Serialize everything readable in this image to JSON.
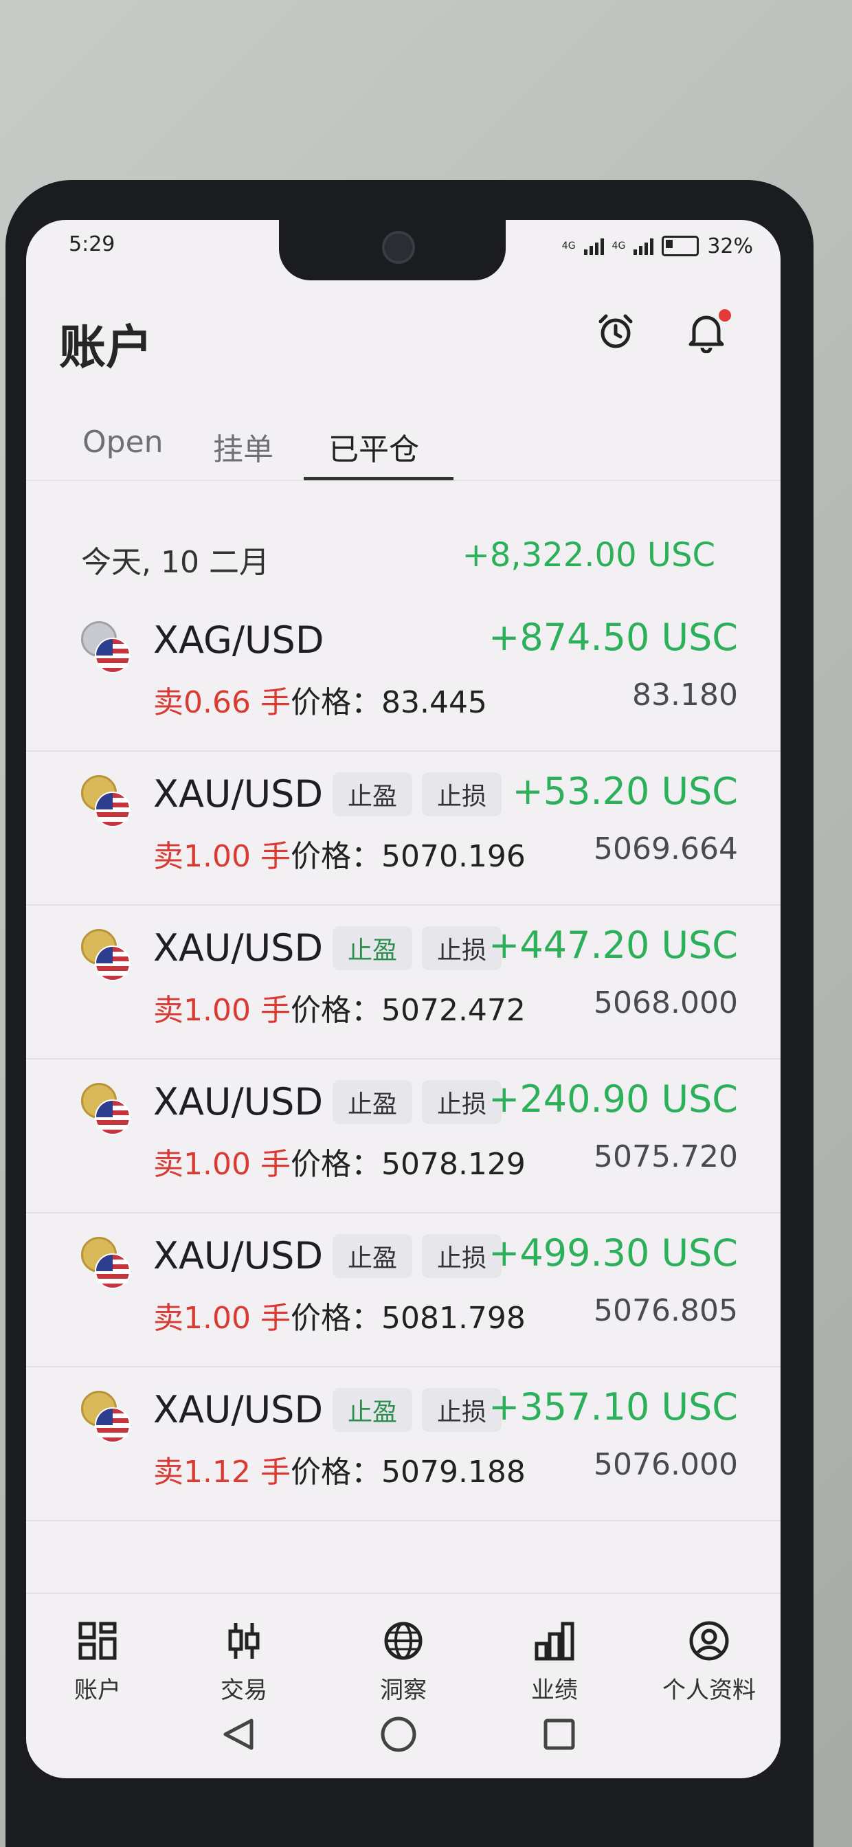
{
  "status_bar": {
    "time": "5:29",
    "network1": "4G",
    "network2": "4G",
    "battery": "32%"
  },
  "header": {
    "title": "账户",
    "icons": [
      "alarm-clock-icon",
      "bell-icon"
    ]
  },
  "tabs": [
    {
      "label": "Open",
      "active": false
    },
    {
      "label": "挂单",
      "active": false
    },
    {
      "label": "已平仓",
      "active": true
    }
  ],
  "day": {
    "label": "今天, 10 二月",
    "total": "+8,322.00 USC"
  },
  "trades": [
    {
      "symbol": "XAG/USD",
      "coin": "silver",
      "tp": "",
      "sl": "",
      "profit": "+874.50 USC",
      "side": "卖0.66 手",
      "price_label": "价格：",
      "open_price": "83.445",
      "close_price": "83.180"
    },
    {
      "symbol": "XAU/USD",
      "coin": "gold",
      "tp": "止盈",
      "sl": "止损",
      "tp_green": false,
      "profit": "+53.20 USC",
      "side": "卖1.00 手",
      "price_label": "价格：",
      "open_price": "5070.196",
      "close_price": "5069.664"
    },
    {
      "symbol": "XAU/USD",
      "coin": "gold",
      "tp": "止盈",
      "sl": "止损",
      "tp_green": true,
      "profit": "+447.20 USC",
      "side": "卖1.00 手",
      "price_label": "价格：",
      "open_price": "5072.472",
      "close_price": "5068.000"
    },
    {
      "symbol": "XAU/USD",
      "coin": "gold",
      "tp": "止盈",
      "sl": "止损",
      "tp_green": false,
      "profit": "+240.90 USC",
      "side": "卖1.00 手",
      "price_label": "价格：",
      "open_price": "5078.129",
      "close_price": "5075.720"
    },
    {
      "symbol": "XAU/USD",
      "coin": "gold",
      "tp": "止盈",
      "sl": "止损",
      "tp_green": false,
      "profit": "+499.30 USC",
      "side": "卖1.00 手",
      "price_label": "价格：",
      "open_price": "5081.798",
      "close_price": "5076.805"
    },
    {
      "symbol": "XAU/USD",
      "coin": "gold",
      "tp": "止盈",
      "sl": "止损",
      "tp_green": true,
      "profit": "+357.10 USC",
      "side": "卖1.12 手",
      "price_label": "价格：",
      "open_price": "5079.188",
      "close_price": "5076.000"
    }
  ],
  "bottom_nav": [
    {
      "label": "账户",
      "icon": "grid-icon"
    },
    {
      "label": "交易",
      "icon": "candlestick-icon"
    },
    {
      "label": "洞察",
      "icon": "globe-icon"
    },
    {
      "label": "业绩",
      "icon": "bar-chart-icon"
    },
    {
      "label": "个人资料",
      "icon": "profile-icon"
    }
  ],
  "colors": {
    "profit_green": "#2db05a",
    "sell_red": "#d93a32",
    "accent_dark": "#222222"
  }
}
